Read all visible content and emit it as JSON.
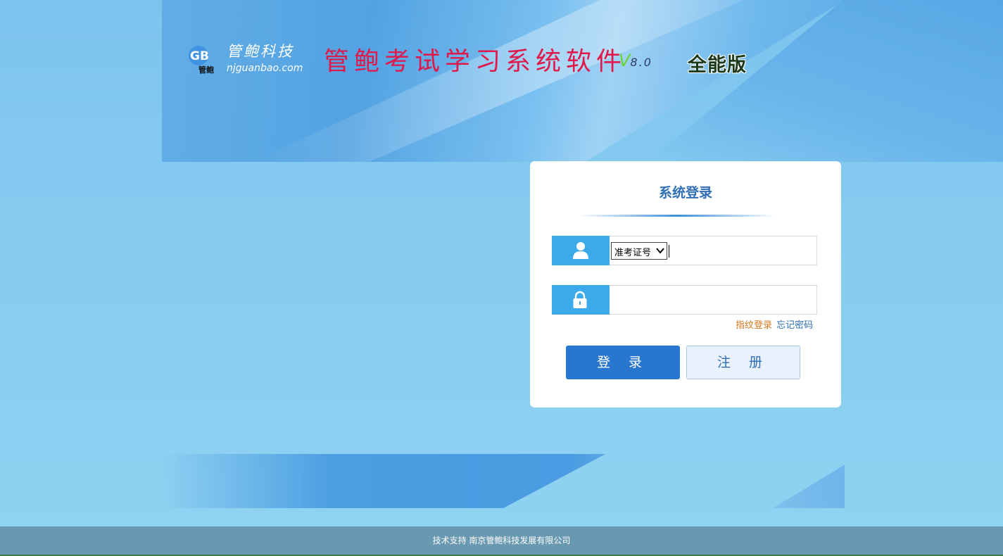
{
  "header": {
    "logo_cn": "管鲍科技",
    "logo_url": "njguanbao.com",
    "logo_small": "管鲍",
    "logo_mark": "GB",
    "title": "管鲍考试学习系统软件",
    "version_v": "V",
    "version_num": "8.0",
    "edition": "全能版"
  },
  "login": {
    "title": "系统登录",
    "id_type_selected": "准考证号",
    "user_value": "",
    "password_value": "",
    "fingerprint_link": "指纹登录",
    "forgot_link": "忘记密码",
    "login_button": "登 录",
    "register_button": "注 册"
  },
  "footer": {
    "text": "技术支持 南京管鲍科技发展有限公司"
  },
  "colors": {
    "title_red": "#e0194a",
    "accent_blue": "#2876d0",
    "icon_blue": "#3ca9ea",
    "fingerprint_orange": "#d6761c",
    "footer_bg": "#6899b0"
  },
  "icons": [
    "user-icon",
    "lock-icon",
    "chevron-down-icon"
  ]
}
